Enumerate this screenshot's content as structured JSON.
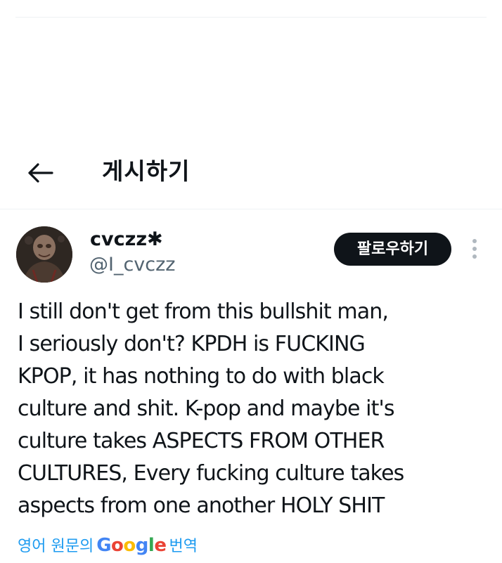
{
  "header": {
    "back_icon": "arrow-left-icon",
    "title": "게시하기"
  },
  "tweet": {
    "author": {
      "display_name": "cvczz✱",
      "handle": "@I_cvczz",
      "avatar_icon": "avatar-image"
    },
    "follow_label": "팔로우하기",
    "more_icon": "vertical-ellipsis-icon",
    "text_lines": [
      "I still don't get from this bullshit man,",
      "I seriously don't? KPDH is FUCKING",
      "KPOP, it has nothing to do with black",
      "culture and shit. K-pop and maybe it's",
      "culture takes ASPECTS FROM OTHER",
      "CULTURES, Every fucking culture takes",
      "aspects from one another HOLY SHIT"
    ],
    "translate": {
      "prefix": "영어 원문의",
      "google": [
        "G",
        "o",
        "o",
        "g",
        "l",
        "e"
      ],
      "suffix": "번역"
    }
  },
  "colors": {
    "text_primary": "#0f1419",
    "text_secondary": "#536471",
    "link": "#1d9bf0",
    "follow_bg": "#0f1419",
    "google_blue": "#4285f4",
    "google_red": "#ea4335",
    "google_yellow": "#fbbc05",
    "google_green": "#34a853"
  }
}
